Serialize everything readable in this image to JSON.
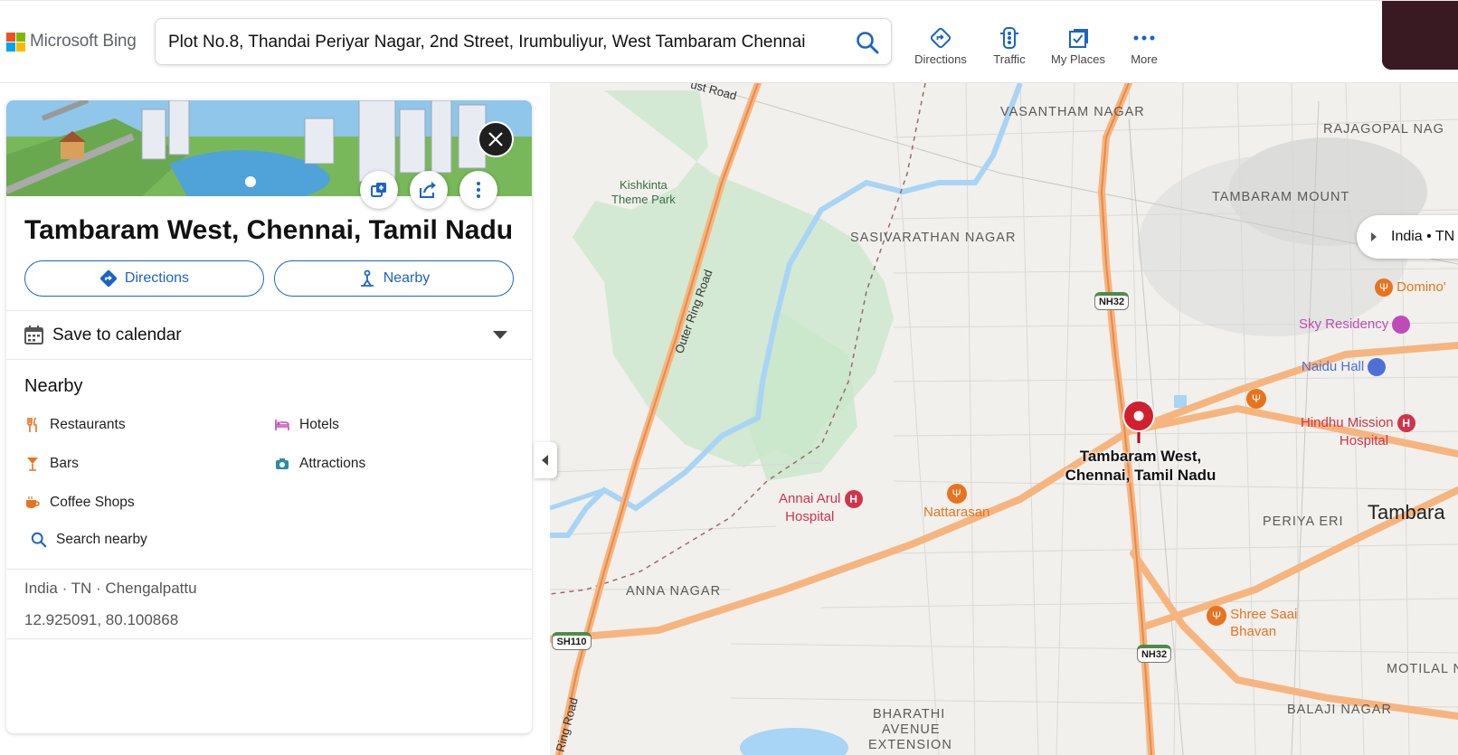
{
  "header": {
    "brand": "Microsoft Bing",
    "brand_colors": [
      "#f25022",
      "#7fba00",
      "#00a4ef",
      "#ffb900"
    ],
    "search_value": "Plot No.8, Thandai Periyar Nagar, 2nd Street, Irumbuliyur, West Tambaram Chennai",
    "nav": [
      {
        "label": "Directions",
        "icon": "directions-icon"
      },
      {
        "label": "Traffic",
        "icon": "traffic-icon"
      },
      {
        "label": "My Places",
        "icon": "my-places-icon"
      },
      {
        "label": "More",
        "icon": "more-icon"
      }
    ]
  },
  "panel": {
    "title": "Tambaram West, Chennai, Tamil Nadu",
    "directions_label": "Directions",
    "nearby_label": "Nearby",
    "calendar_label": "Save to calendar",
    "nearby_heading": "Nearby",
    "nearby_items": [
      {
        "label": "Restaurants",
        "icon": "restaurant-icon"
      },
      {
        "label": "Hotels",
        "icon": "hotel-icon"
      },
      {
        "label": "Bars",
        "icon": "bar-icon"
      },
      {
        "label": "Attractions",
        "icon": "attraction-icon"
      },
      {
        "label": "Coffee Shops",
        "icon": "coffee-icon"
      },
      {
        "label": "Search nearby",
        "icon": "search-icon"
      }
    ],
    "location_path": "India · TN · Chengalpattu",
    "coordinates": "12.925091, 80.100868",
    "accent": "#1b64c4"
  },
  "map": {
    "breadcrumb": "India • TN",
    "pin_label_line1": "Tambaram West,",
    "pin_label_line2": "Chennai, Tamil Nadu",
    "areas": [
      "VASANTHAM NAGAR",
      "RAJAGOPAL NAG",
      "TAMBARAM MOUNT",
      "SASIVARATHAN NAGAR",
      "PERIYA ERI",
      "ANNA NAGAR",
      "MOTILAL NA",
      "BALAJI NAGAR",
      "BHARATHI",
      "AVENUE",
      "EXTENSION",
      "Tambara"
    ],
    "roads": [
      "ust Road",
      "Outer Ring Road",
      "Ring Road"
    ],
    "shields": [
      "NH32",
      "NH32",
      "SH110"
    ],
    "park": [
      "Kishkinta",
      "Theme Park"
    ],
    "pois": [
      {
        "name": "Domino'",
        "kind": "restaurant",
        "color": "#e8731f"
      },
      {
        "name": "Sky Residency",
        "kind": "hotel",
        "color": "#c04bb8"
      },
      {
        "name": "Naidu Hall",
        "kind": "shopping",
        "color": "#4f6fd8"
      },
      {
        "name": "Hindhu Mission",
        "name2": "Hospital",
        "kind": "hospital",
        "color": "#d0344a"
      },
      {
        "name": "Annai Arul",
        "name2": "Hospital",
        "kind": "hospital",
        "color": "#d0344a"
      },
      {
        "name": "Nattarasan",
        "kind": "restaurant",
        "color": "#e8731f"
      },
      {
        "name": "Shree Saai",
        "name2": "Bhavan",
        "kind": "restaurant",
        "color": "#e8731f"
      }
    ]
  }
}
